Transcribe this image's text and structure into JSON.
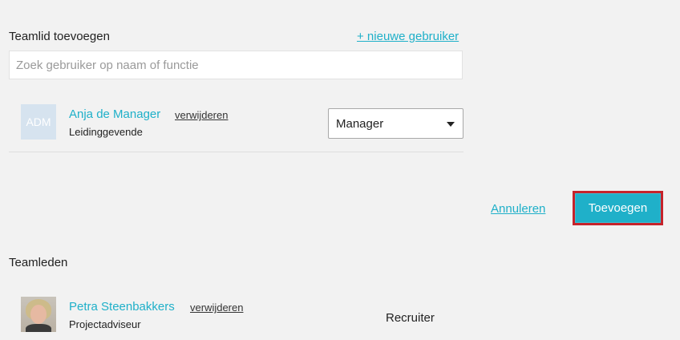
{
  "add_member": {
    "title": "Teamlid toevoegen",
    "new_user_link": "+ nieuwe gebruiker",
    "search_placeholder": "Zoek gebruiker op naam of functie",
    "candidate": {
      "avatar_text": "ADM",
      "name": "Anja de Manager",
      "remove_label": "verwijderen",
      "subtitle": "Leidinggevende",
      "role_selected": "Manager"
    },
    "cancel_label": "Annuleren",
    "add_label": "Toevoegen"
  },
  "team_members": {
    "title": "Teamleden",
    "members": [
      {
        "name": "Petra Steenbakkers",
        "remove_label": "verwijderen",
        "subtitle": "Projectadviseur",
        "role": "Recruiter"
      }
    ]
  },
  "colors": {
    "accent": "#1fb0c9",
    "highlight_border": "#c5232b",
    "background": "#f2f2f2"
  }
}
